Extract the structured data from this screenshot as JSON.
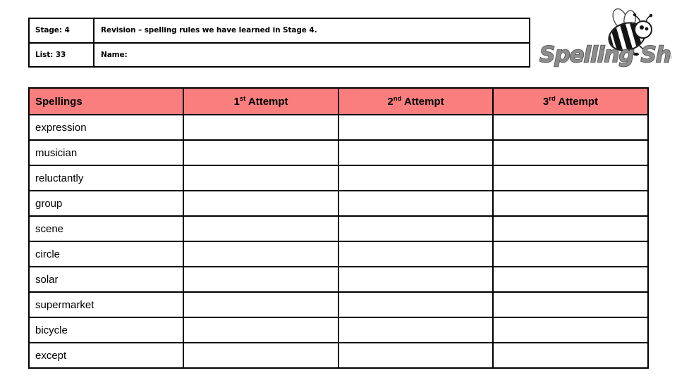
{
  "header": {
    "stage_label": "Stage: 4",
    "list_label": "List: 33",
    "revision_text": "Revision – spelling rules we have learned in Stage 4.",
    "name_label": "Name:"
  },
  "logo": {
    "text": "Spelling Shed",
    "bee_icon": "bee-icon",
    "color": "#7a7a7a"
  },
  "table": {
    "header_bg": "#FB7E7E",
    "columns": [
      {
        "label": "Spellings",
        "sup": ""
      },
      {
        "label": "Attempt",
        "number": "1",
        "sup": "st"
      },
      {
        "label": "Attempt",
        "number": "2",
        "sup": "nd"
      },
      {
        "label": "Attempt",
        "number": "3",
        "sup": "rd"
      }
    ],
    "words": [
      "expression",
      "musician",
      "reluctantly",
      "group",
      "scene",
      "circle",
      "solar",
      "supermarket",
      "bicycle",
      "except"
    ]
  }
}
